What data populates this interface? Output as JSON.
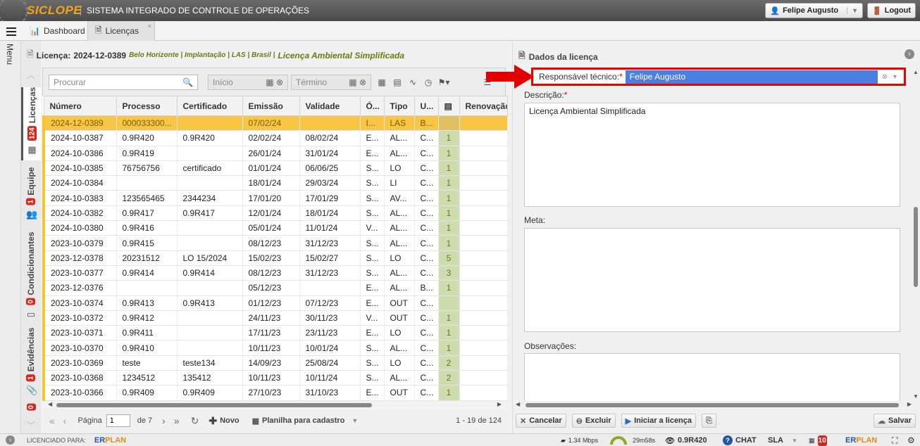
{
  "header": {
    "logo": "SICLOPE",
    "system_name": "SISTEMA INTEGRADO DE CONTROLE DE OPERAÇÕES",
    "user": "Felipe Augusto",
    "logout": "Logout"
  },
  "tabs": {
    "dashboard": "Dashboard",
    "licencas": "Licenças",
    "close": "×"
  },
  "menu_label": "Menu",
  "side_tabs": {
    "licencas": {
      "label": "Licenças",
      "count": "124"
    },
    "equipe": {
      "label": "Equipe",
      "count": "1"
    },
    "condicionantes": {
      "label": "Condicionantes",
      "count": "0"
    },
    "evidencias": {
      "label": "Evidências",
      "count": "1"
    },
    "other": {
      "count": "0"
    }
  },
  "license_header": {
    "label": "Licença:",
    "number": "2024-12-0389",
    "location": "Belo Horizonte | Implantação | LAS | Brasil |",
    "title": "Licença Ambiental Simplificada"
  },
  "toolbar": {
    "search_placeholder": "Procurar",
    "inicio": "Início",
    "termino": "Término"
  },
  "grid": {
    "columns": [
      "Número",
      "Processo",
      "Certificado",
      "Emissão",
      "Validade",
      "Ó...",
      "Tipo",
      "U...",
      "",
      "Renovação"
    ],
    "rows": [
      [
        "2024-12-0389",
        "000033300...",
        "",
        "07/02/24",
        "",
        "I...",
        "LAS",
        "B...",
        ""
      ],
      [
        "2024-10-0387",
        "0.9R420",
        "0.9R420",
        "02/02/24",
        "08/02/24",
        "E...",
        "AL...",
        "C...",
        "1"
      ],
      [
        "2024-10-0386",
        "0.9R419",
        "",
        "26/01/24",
        "31/01/24",
        "E...",
        "AL...",
        "C...",
        "1"
      ],
      [
        "2024-10-0385",
        "76756756",
        "certificado",
        "01/01/24",
        "06/06/25",
        "S...",
        "LO",
        "C...",
        "1"
      ],
      [
        "2024-10-0384",
        "",
        "",
        "18/01/24",
        "29/03/24",
        "S...",
        "LI",
        "C...",
        "1"
      ],
      [
        "2024-10-0383",
        "123565465",
        "2344234",
        "17/01/20",
        "17/01/29",
        "S...",
        "AV...",
        "C...",
        "1"
      ],
      [
        "2024-10-0382",
        "0.9R417",
        "0.9R417",
        "12/01/24",
        "18/01/24",
        "S...",
        "AL...",
        "C...",
        "1"
      ],
      [
        "2024-10-0380",
        "0.9R416",
        "",
        "05/01/24",
        "11/01/24",
        "V...",
        "AL...",
        "C...",
        "1"
      ],
      [
        "2023-10-0379",
        "0.9R415",
        "",
        "08/12/23",
        "31/12/23",
        "S...",
        "AL...",
        "C...",
        "1"
      ],
      [
        "2023-12-0378",
        "20231512",
        "LO 15/2024",
        "15/02/23",
        "15/02/27",
        "S...",
        "LO",
        "C...",
        "5"
      ],
      [
        "2023-10-0377",
        "0.9R414",
        "0.9R414",
        "08/12/23",
        "31/12/23",
        "S...",
        "AL...",
        "C...",
        "3"
      ],
      [
        "2023-12-0376",
        "",
        "",
        "05/12/23",
        "",
        "E...",
        "AL...",
        "B...",
        "1"
      ],
      [
        "2023-10-0374",
        "0.9R413",
        "0.9R413",
        "01/12/23",
        "07/12/23",
        "E...",
        "OUT",
        "C...",
        ""
      ],
      [
        "2023-10-0372",
        "0.9R412",
        "",
        "24/11/23",
        "30/11/23",
        "V...",
        "OUT",
        "C...",
        "1"
      ],
      [
        "2023-10-0371",
        "0.9R411",
        "",
        "17/11/23",
        "23/11/23",
        "E...",
        "LO",
        "C...",
        "1"
      ],
      [
        "2023-10-0370",
        "0.9R410",
        "",
        "10/11/23",
        "10/01/24",
        "S...",
        "AL...",
        "C...",
        "1"
      ],
      [
        "2023-10-0369",
        "teste",
        "teste134",
        "14/09/23",
        "25/08/24",
        "S...",
        "LO",
        "C...",
        "2"
      ],
      [
        "2023-10-0368",
        "1234512",
        "135412",
        "10/11/23",
        "10/11/24",
        "S...",
        "AL...",
        "C...",
        "2"
      ],
      [
        "2023-10-0366",
        "0.9R409",
        "0.9R409",
        "27/10/23",
        "31/10/23",
        "E...",
        "OUT",
        "C...",
        "1"
      ]
    ]
  },
  "pager": {
    "pagina": "Página",
    "page": "1",
    "de": "de 7",
    "novo": "Novo",
    "planilha": "Planilha para cadastro",
    "range": "1 - 19 de 124"
  },
  "details": {
    "title": "Dados da licença",
    "responsavel_label": "Responsável técnico:",
    "required": "*",
    "responsavel_value": "Felipe Augusto",
    "descricao_label": "Descrição:",
    "descricao_value": "Licença Ambiental Simplificada",
    "meta_label": "Meta:",
    "observacoes_label": "Observações:",
    "cancelar": "Cancelar",
    "excluir": "Excluir",
    "iniciar": "Iniciar a licença",
    "salvar": "Salvar"
  },
  "footer": {
    "licenciado": "LICENCIADO PARA:",
    "erplan_er": "ER",
    "erplan_plan": "PLAN",
    "speed": "1.34 Mbps",
    "timer": "29m58s",
    "process": "0.9R420",
    "chat": "CHAT",
    "sla": "SLA",
    "notif": "10"
  },
  "colors": {
    "accent": "#f5a31a",
    "selected_row": "#f8c545",
    "count_cell": "#cfdcb0",
    "highlight": "#e00000",
    "select_blue": "#4a7fe0"
  }
}
